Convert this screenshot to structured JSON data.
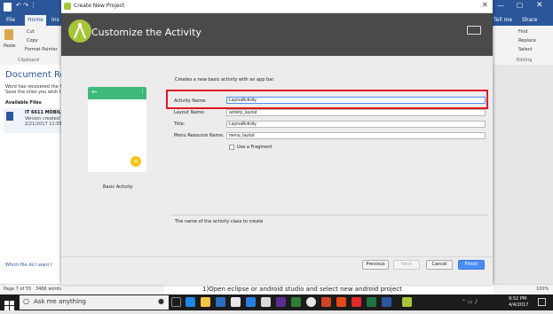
{
  "word": {
    "titlebar_icons": "↶ ↷ ⋮",
    "tabs": {
      "file": "File",
      "home": "Home",
      "insert": "Ins",
      "tell_me": "Tell me",
      "share": "Share"
    },
    "ribbon": {
      "paste": "Paste",
      "cut": "Cut",
      "copy": "Copy",
      "format_painter": "Format Painter",
      "clipboard": "Clipboard",
      "find": "Find",
      "replace": "Replace",
      "select": "Select",
      "editing": "Editing"
    },
    "recovery": {
      "title": "Document Rec",
      "message_line1": "Word has recovered the fi",
      "message_line2": "Save the ones you wish to",
      "available_files": "Available Files",
      "file_name": "IT 6611 MOBILE",
      "file_version": "Version created l",
      "file_date": "2/21/2017 11:58 P",
      "help_link": "Which file do I want t"
    },
    "status": {
      "page": "Page 7 of 55",
      "words": "3466 words",
      "zoom": "100%"
    },
    "doc_text": "1)Open eclipse or android studio and select new android project"
  },
  "taskbar": {
    "search_placeholder": "Ask me anything",
    "time": "9:52 PM",
    "date": "4/4/2017"
  },
  "dialog": {
    "window_title": "Create New Project",
    "header_title": "Customize the Activity",
    "template_name": "Basic Activity",
    "intro": "Creates a new basic activity with an app bar.",
    "fields": {
      "activity_name_label": "Activity Name:",
      "activity_name_value": "LayoutActivity",
      "layout_name_label": "Layout Name:",
      "layout_name_value": "activity_layout",
      "title_label": "Title:",
      "title_value": "LayoutActivity",
      "menu_label": "Menu Resource Name:",
      "menu_value": "menu_layout",
      "fragment_label": "Use a Fragment"
    },
    "help_text": "The name of the activity class to create",
    "buttons": {
      "previous": "Previous",
      "next": "Next",
      "cancel": "Cancel",
      "finish": "Finish"
    }
  },
  "colors": {
    "word_blue": "#2b579a",
    "android_green": "#a4c639",
    "header_dark": "#4a4a4a",
    "highlight_red": "#e0181f",
    "finish_blue": "#4b8df8",
    "fab_yellow": "#f9c31a"
  }
}
